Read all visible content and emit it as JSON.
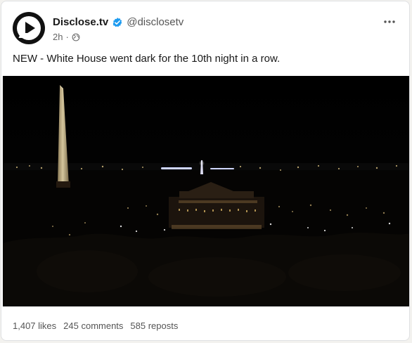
{
  "post": {
    "author_name": "Disclose.tv",
    "handle": "@disclosetv",
    "time": "2h",
    "separator": "·",
    "text": "NEW - White House went dark for the 10th night in a row."
  },
  "stats": {
    "likes": "1,407 likes",
    "comments": "245 comments",
    "reposts": "585 reposts"
  },
  "icons": {
    "avatar": "play-logo-icon",
    "verified": "verified-badge-icon",
    "visibility": "globe-icon",
    "menu": "more-options-icon"
  },
  "colors": {
    "verified": "#1d9bf0",
    "card_background": "#ffffff",
    "page_background": "#f3f2ef"
  }
}
